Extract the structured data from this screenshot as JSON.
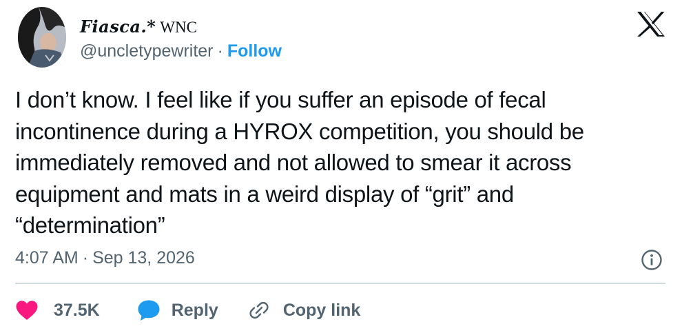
{
  "author": {
    "display_name": "Fiasca.*",
    "display_name_suffix": "WNC",
    "handle": "@uncletypewriter",
    "separator": "·",
    "follow_label": "Follow"
  },
  "tweet": {
    "text": "I don’t know. I feel like if you suffer an episode of fecal incontinence during a HYROX competition, you should be immediately removed and not allowed to smear it across equipment and mats in a weird display of “grit” and “determination”",
    "time": "4:07 AM",
    "separator": "·",
    "date": "Sep 13, 2026"
  },
  "actions": {
    "likes_count": "37.5K",
    "reply_label": "Reply",
    "copy_link_label": "Copy link"
  },
  "icons": {
    "brand": "x-logo-icon",
    "info": "info-icon",
    "like": "heart-icon",
    "reply": "speech-bubble-icon",
    "copy_link": "link-icon"
  },
  "colors": {
    "accent": "#1d9bf0",
    "heart": "#f91880",
    "text": "#0f1419",
    "secondary": "#536471",
    "divider": "#cfd9de"
  }
}
